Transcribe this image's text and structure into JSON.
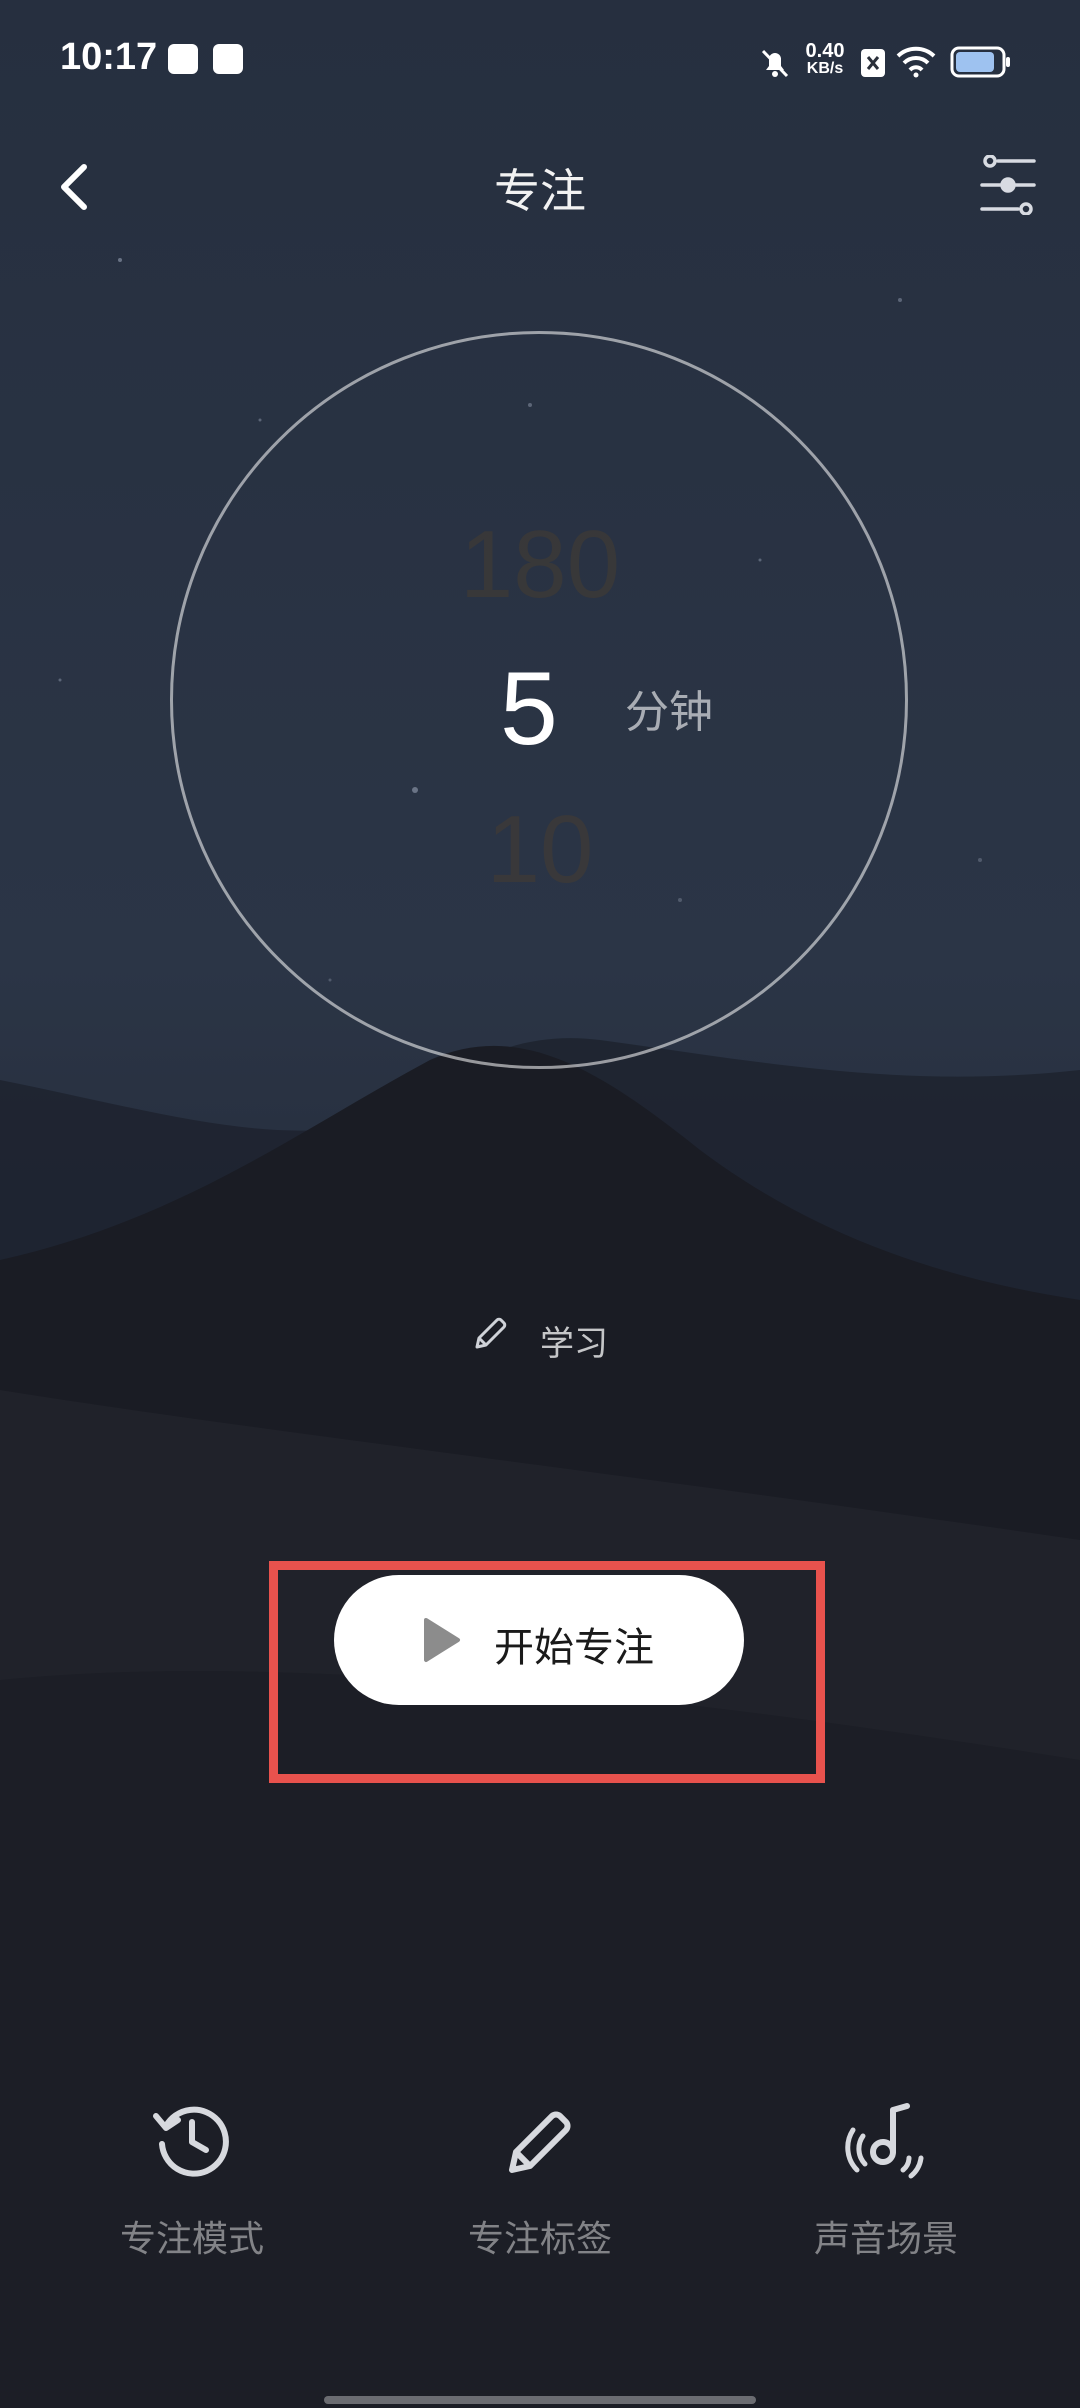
{
  "status_bar": {
    "time": "10:17",
    "network_speed_value": "0.40",
    "network_speed_unit": "KB/s"
  },
  "header": {
    "title": "专注",
    "back_icon": "chevron-left-icon",
    "settings_icon": "sliders-icon"
  },
  "timer": {
    "above_value": "180",
    "value": "5",
    "unit": "分钟",
    "below_value": "10"
  },
  "tag": {
    "icon": "pencil-icon",
    "label": "学习"
  },
  "start_button": {
    "icon": "play-icon",
    "label": "开始专注"
  },
  "bottom_nav": [
    {
      "icon": "history-clock-icon",
      "label": "专注模式"
    },
    {
      "icon": "pencil-icon",
      "label": "专注标签"
    },
    {
      "icon": "music-note-icon",
      "label": "声音场景"
    }
  ],
  "colors": {
    "highlight": "#e8524d",
    "button_bg": "#ffffff"
  }
}
